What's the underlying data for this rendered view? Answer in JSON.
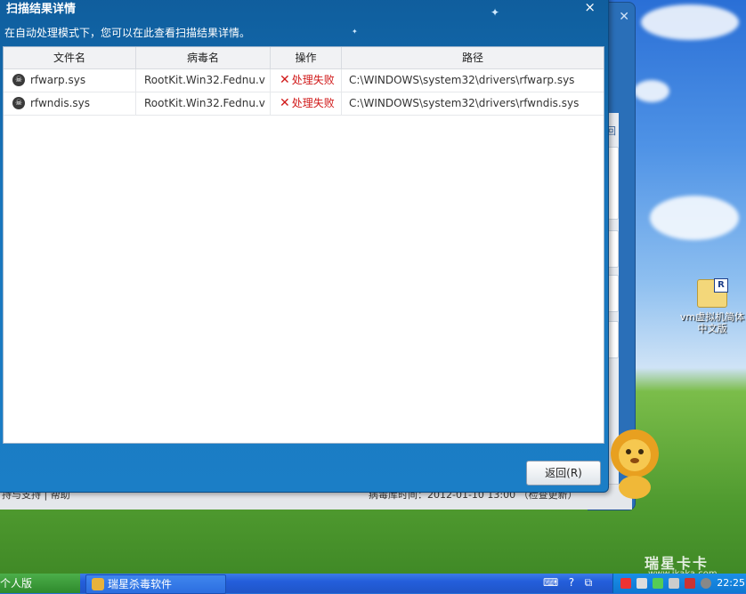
{
  "dialog": {
    "title": "扫描结果详情",
    "subtitle": "在自动处理模式下，您可以在此查看扫描结果详情。",
    "close_icon": "×",
    "columns": [
      "文件名",
      "病毒名",
      "操作",
      "路径"
    ],
    "rows": [
      {
        "file": "rfwarp.sys",
        "virus": "RootKit.Win32.Fednu.v",
        "action": "处理失败",
        "path": "C:\\WINDOWS\\system32\\drivers\\rfwarp.sys"
      },
      {
        "file": "rfwndis.sys",
        "virus": "RootKit.Win32.Fednu.v",
        "action": "处理失败",
        "path": "C:\\WINDOWS\\system32\\drivers\\rfwndis.sys"
      }
    ],
    "return_button": "返回(R)"
  },
  "background_app": {
    "header_char": "回",
    "status_left": "持与支持 | 帮助",
    "status_right": "病毒库时间：2012-01-10 13:00 （检查更新）"
  },
  "desktop": {
    "icon_label": "vm虚拟机简体中文版",
    "watermark_title": "瑞星卡卡",
    "watermark_url": "www.ikaka.com"
  },
  "taskbar": {
    "start_label": "个人版",
    "task_label": "瑞星杀毒软件",
    "clock": "22:25"
  },
  "colors": {
    "dialog_blue": "#1875bc",
    "fail_red": "#d01818",
    "taskbar_blue": "#245edb"
  }
}
